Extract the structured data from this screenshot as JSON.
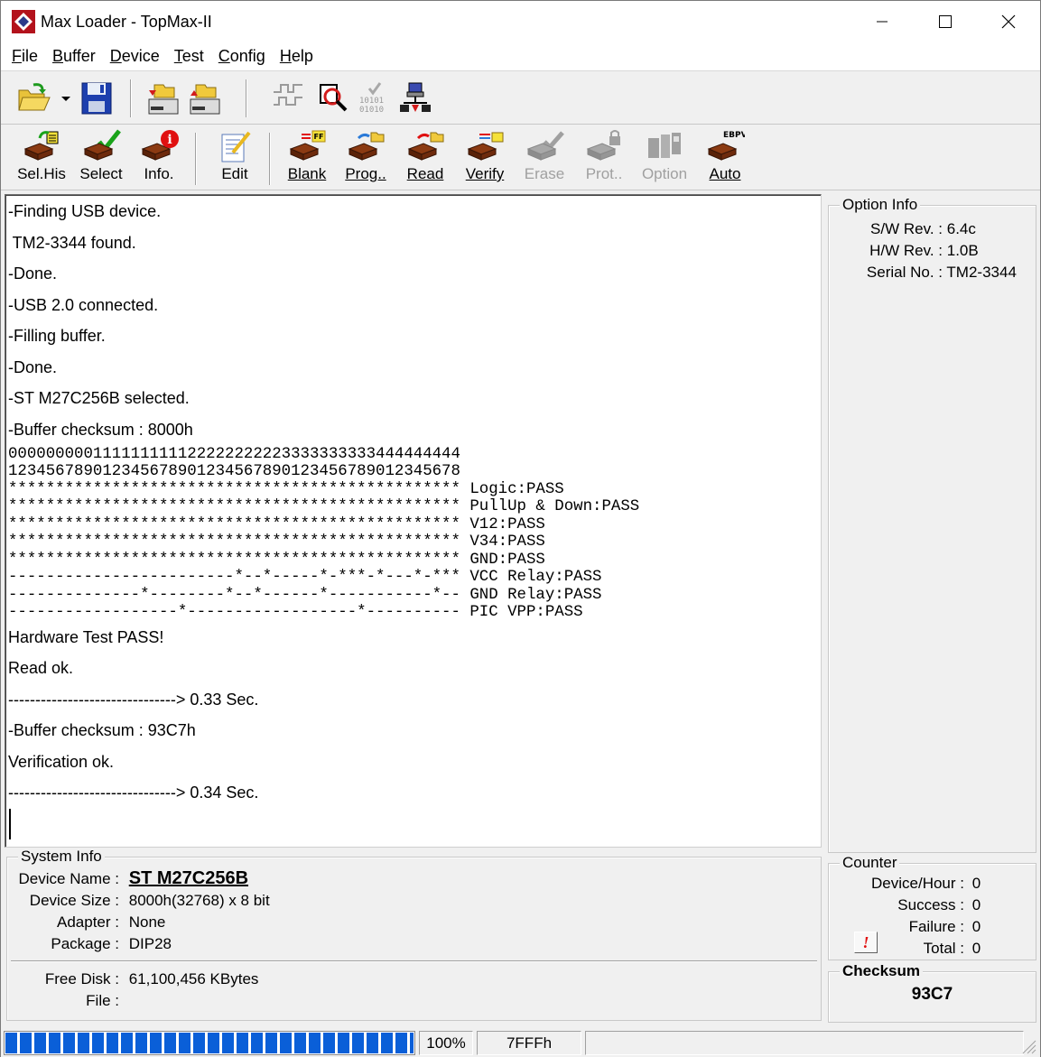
{
  "window": {
    "title": "Max Loader - TopMax-II"
  },
  "menu": [
    {
      "first": "F",
      "rest": "ile"
    },
    {
      "first": "B",
      "rest": "uffer"
    },
    {
      "first": "D",
      "rest": "evice"
    },
    {
      "first": "T",
      "rest": "est"
    },
    {
      "first": "C",
      "rest": "onfig"
    },
    {
      "first": "H",
      "rest": "elp"
    }
  ],
  "toolbar2": {
    "selhis": "Sel.His",
    "select": "Select",
    "info": "Info.",
    "edit": "Edit",
    "blank": "Blank",
    "prog": "Prog..",
    "read": "Read",
    "verify": "Verify",
    "erase": "Erase",
    "prot": "Prot..",
    "option": "Option",
    "auto": "Auto",
    "auto_badge": "EBPV"
  },
  "log": {
    "l1": "-Finding USB device.",
    "l2": " TM2-3344 found.",
    "l3": "-Done.",
    "l4": "-USB 2.0 connected.",
    "l5": "-Filling buffer.",
    "l6": "-Done.",
    "l7": "-ST M27C256B selected.",
    "l8": "-Buffer checksum : 8000h",
    "pins1": "000000000111111111122222222223333333333444444444",
    "pins2": "123456789012345678901234567890123456789012345678",
    "r1": "************************************************ Logic:PASS",
    "r2": "************************************************ PullUp & Down:PASS",
    "r3": "************************************************ V12:PASS",
    "r4": "************************************************ V34:PASS",
    "r5": "************************************************ GND:PASS",
    "r6": "------------------------*--*-----*-***-*---*-*** VCC Relay:PASS",
    "r7": "--------------*--------*--*------*-----------*-- GND Relay:PASS",
    "r8": "------------------*------------------*---------- PIC VPP:PASS",
    "l9": "Hardware Test PASS!",
    "l10": "Read ok.",
    "l11": "-------------------------------> 0.33 Sec.",
    "l12": "-Buffer checksum : 93C7h",
    "l13": "Verification ok.",
    "l14": "-------------------------------> 0.34 Sec."
  },
  "option_info": {
    "title": "Option Info",
    "sw_label": "S/W Rev. :",
    "sw_value": "6.4c",
    "hw_label": "H/W Rev. :",
    "hw_value": "1.0B",
    "serial_label": "Serial No. :",
    "serial_value": "TM2-3344"
  },
  "system_info": {
    "title": "System Info",
    "device_name_label": "Device Name :",
    "device_name": "ST M27C256B",
    "device_size_label": "Device Size :",
    "device_size": "8000h(32768) x 8 bit",
    "adapter_label": "Adapter :",
    "adapter": "None",
    "package_label": "Package :",
    "package": "DIP28",
    "free_disk_label": "Free Disk :",
    "free_disk": "61,100,456 KBytes",
    "file_label": "File :",
    "file": ""
  },
  "counter": {
    "title": "Counter",
    "device_hour_label": "Device/Hour :",
    "device_hour": "0",
    "success_label": "Success :",
    "success": "0",
    "failure_label": "Failure :",
    "failure": "0",
    "total_label": "Total :",
    "total": "0",
    "reset_glyph": "!"
  },
  "checksum": {
    "title": "Checksum",
    "value": "93C7"
  },
  "status": {
    "progress_percent": 100,
    "percent_text": "100%",
    "address": "7FFFh"
  },
  "colors": {
    "progress": "#0a5fd8",
    "chip": "#8b3a12",
    "check": "#1aa31a",
    "info_red": "#e01010"
  }
}
